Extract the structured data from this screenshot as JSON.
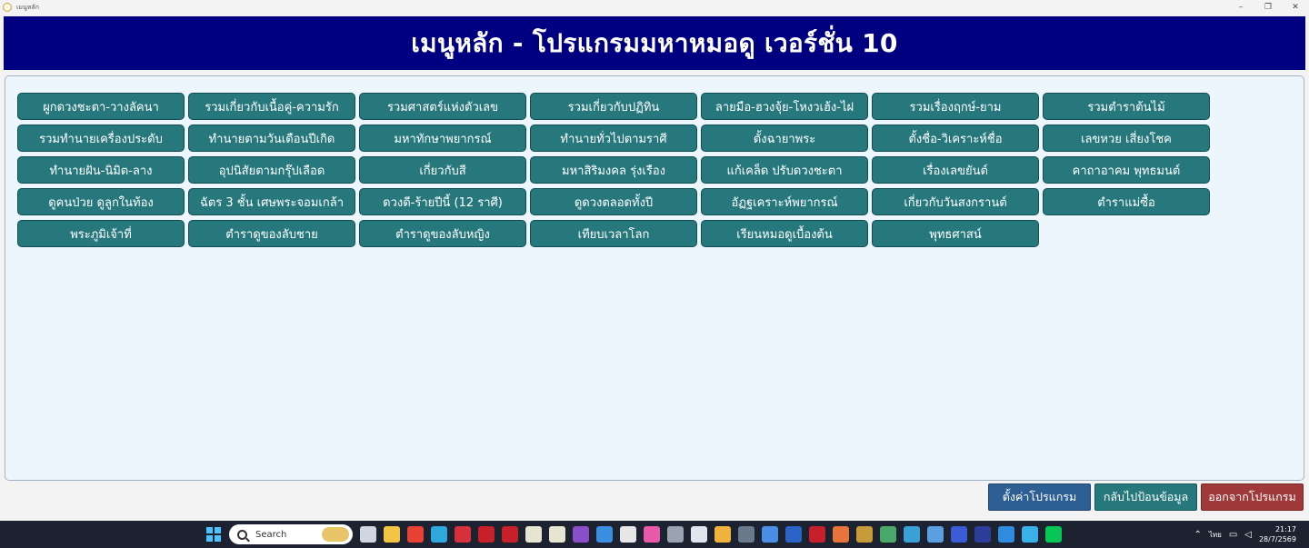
{
  "window": {
    "title": "เมนูหลัก",
    "minimize": "–",
    "maximize": "❐",
    "close": "✕"
  },
  "header": {
    "title": "เมนูหลัก - โปรแกรมมหาหมอดู เวอร์ชั่น 10"
  },
  "menu": {
    "items": [
      {
        "label": "ผูกดวงชะตา-วางลัคนา"
      },
      {
        "label": "รวมเกี่ยวกับเนื้อคู่-ความรัก"
      },
      {
        "label": "รวมศาสตร์แห่งตัวเลข"
      },
      {
        "label": "รวมเกี่ยวกับปฏิทิน"
      },
      {
        "label": "ลายมือ-ฮวงจุ้ย-โหงวเฮ้ง-ไฝ"
      },
      {
        "label": "รวมเรื่องฤกษ์-ยาม"
      },
      {
        "label": "รวมตำราต้นไม้"
      },
      {
        "label": "รวมทำนายเครื่องประดับ"
      },
      {
        "label": "ทำนายตามวันเดือนปีเกิด"
      },
      {
        "label": "มหาทักษาพยากรณ์"
      },
      {
        "label": "ทำนายทั่วไปตามราศี"
      },
      {
        "label": "ตั้งฉายาพระ"
      },
      {
        "label": "ตั้งชื่อ-วิเคราะห์ชื่อ"
      },
      {
        "label": "เลขหวย เสี่ยงโชค"
      },
      {
        "label": "ทำนายฝัน-นิมิต-ลาง"
      },
      {
        "label": "อุปนิสัยตามกรุ๊ปเลือด"
      },
      {
        "label": "เกี่ยวกับสี"
      },
      {
        "label": "มหาสิริมงคล รุ่งเรือง"
      },
      {
        "label": "แก้เคล็ด ปรับดวงชะตา"
      },
      {
        "label": "เรื่องเลขยันต์"
      },
      {
        "label": "คาถาอาคม พุทธมนต์"
      },
      {
        "label": "ดูคนป่วย ดูลูกในท้อง"
      },
      {
        "label": "ฉัตร 3 ชั้น เศษพระจอมเกล้า"
      },
      {
        "label": "ดวงดี-ร้ายปีนี้ (12 ราศี)"
      },
      {
        "label": "ดูดวงตลอดทั้งปี"
      },
      {
        "label": "อัฏฐเคราะห์พยากรณ์"
      },
      {
        "label": "เกี่ยวกับวันสงกรานต์"
      },
      {
        "label": "ตำราแม่ซื้อ"
      },
      {
        "label": "พระภูมิเจ้าที่"
      },
      {
        "label": "ตำราดูของลับชาย"
      },
      {
        "label": "ตำราดูของลับหญิง"
      },
      {
        "label": "เทียบเวลาโลก"
      },
      {
        "label": "เรียนหมอดูเบื้องต้น"
      },
      {
        "label": "พุทธศาสน์"
      }
    ]
  },
  "footer": {
    "settings": "ตั้งค่าโปรแกรม",
    "back": "กลับไปป้อนข้อมูล",
    "exit": "ออกจากโปรแกรม"
  },
  "taskbar": {
    "search_placeholder": "Search",
    "lang": "ไทย",
    "time": "21:17",
    "date": "28/7/2569",
    "icons": [
      {
        "name": "task-view-icon",
        "color": "#cfd6e0"
      },
      {
        "name": "file-explorer-icon",
        "color": "#f4c542"
      },
      {
        "name": "chrome-icon",
        "color": "#e94235"
      },
      {
        "name": "edge-icon",
        "color": "#2fa6dc"
      },
      {
        "name": "app-red-icon",
        "color": "#d6303a"
      },
      {
        "name": "app-thai-red-icon",
        "color": "#c8202a"
      },
      {
        "name": "app-thai-red-2-icon",
        "color": "#c8202a"
      },
      {
        "name": "clock-app-icon",
        "color": "#e8e4d2"
      },
      {
        "name": "clock-app-2-icon",
        "color": "#e8e4d2"
      },
      {
        "name": "visual-studio-icon",
        "color": "#8a4ecb"
      },
      {
        "name": "vscode-icon",
        "color": "#3c8fe0"
      },
      {
        "name": "openai-icon",
        "color": "#e6e6e6"
      },
      {
        "name": "photos-icon",
        "color": "#e85aa8"
      },
      {
        "name": "calculator-icon",
        "color": "#9aa3b0"
      },
      {
        "name": "notepad-icon",
        "color": "#dfe6ee"
      },
      {
        "name": "settings-gear-icon",
        "color": "#f0b43c"
      },
      {
        "name": "media-icon",
        "color": "#6b7a8a"
      },
      {
        "name": "document-icon",
        "color": "#4a8ee6"
      },
      {
        "name": "word-icon",
        "color": "#2b63c6"
      },
      {
        "name": "app-thai-text-icon",
        "color": "#c8202a"
      },
      {
        "name": "paint-icon",
        "color": "#e8743c"
      },
      {
        "name": "coin-icon",
        "color": "#c79a3a"
      },
      {
        "name": "money-bag-icon",
        "color": "#4aa86a"
      },
      {
        "name": "globe-icon",
        "color": "#3aa0d8"
      },
      {
        "name": "network-icon",
        "color": "#5aa0e0"
      },
      {
        "name": "app-blue-icon",
        "color": "#3b5bd6"
      },
      {
        "name": "app-dark-blue-icon",
        "color": "#2c3e9a"
      },
      {
        "name": "app-arrow-icon",
        "color": "#2f8be0"
      },
      {
        "name": "snip-icon",
        "color": "#3bb0e8"
      },
      {
        "name": "line-icon",
        "color": "#06c755"
      }
    ]
  }
}
